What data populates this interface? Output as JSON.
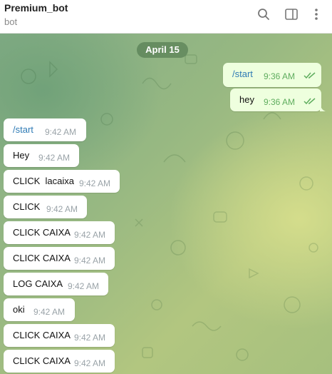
{
  "header": {
    "title": "Premium_bot",
    "subtitle": "bot",
    "icons": [
      "search-icon",
      "sidebar-toggle-icon",
      "more-vertical-icon"
    ]
  },
  "colors": {
    "outgoing_bubble": "#eeffde",
    "incoming_bubble": "#ffffff",
    "command_link": "#2f7bb5",
    "read_ticks": "#5fad5e"
  },
  "chat": {
    "date_separator": "April 15",
    "outgoing": [
      {
        "text": "/start",
        "time": "9:36 AM",
        "status": "read"
      },
      {
        "text": "hey",
        "time": "9:36 AM",
        "status": "read"
      }
    ],
    "incoming": [
      {
        "text": "/start",
        "time": "9:42 AM"
      },
      {
        "text": "Hey",
        "time": "9:42 AM"
      },
      {
        "text": "CLICK  lacaixa",
        "time": "9:42 AM"
      },
      {
        "text": "CLICK",
        "time": "9:42 AM"
      },
      {
        "text": "CLICK CAIXA",
        "time": "9:42 AM"
      },
      {
        "text": "CLICK CAIXA",
        "time": "9:42 AM"
      },
      {
        "text": "LOG CAIXA",
        "time": "9:42 AM"
      },
      {
        "text": "oki",
        "time": "9:42 AM"
      },
      {
        "text": "CLICK CAIXA",
        "time": "9:42 AM"
      },
      {
        "text": "CLICK CAIXA",
        "time": "9:42 AM"
      }
    ]
  }
}
